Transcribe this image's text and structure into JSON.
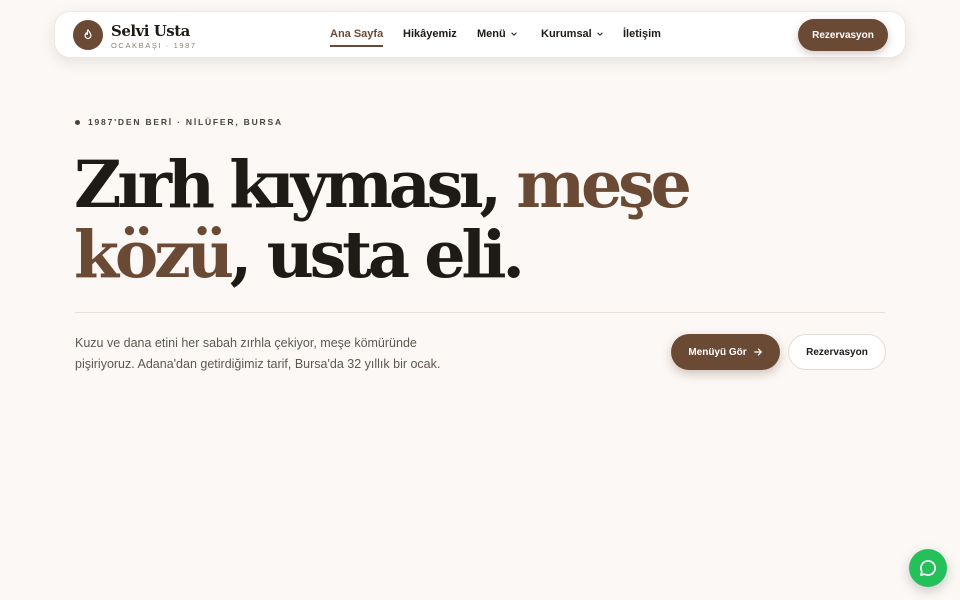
{
  "brand": {
    "name": "Selvi Usta",
    "subtitle": "OCAKBAŞI · 1987",
    "icon": "flame-icon"
  },
  "nav": {
    "items": [
      {
        "label": "Ana Sayfa",
        "active": true
      },
      {
        "label": "Hikâyemiz"
      },
      {
        "label": "Menü",
        "dropdown": true
      },
      {
        "label": "Kurumsal",
        "dropdown": true
      },
      {
        "label": "İletişim"
      }
    ],
    "cta": "Rezervasyon"
  },
  "hero": {
    "eyebrow": "1987'DEN BERİ · NİLÜFER, BURSA",
    "headline": {
      "part1": "Zırh kıyması, ",
      "accent1": "meşe",
      "accent2": "közü",
      "part2": ", usta eli."
    },
    "lead": "Kuzu ve dana etini her sabah zırhla çekiyor, meşe kömüründe pişiriyoruz. Adana'dan getirdiğimiz tarif, Bursa'da 32 yıllık bir ocak.",
    "primary_button": "Menüyü Gör",
    "secondary_button": "Rezervasyon"
  },
  "chat": {
    "icon": "chat-bubble-icon"
  },
  "colors": {
    "accent": "#6b4a35",
    "background": "#fcf8f5",
    "text": "#1e1a16",
    "chat": "#25c05a"
  }
}
